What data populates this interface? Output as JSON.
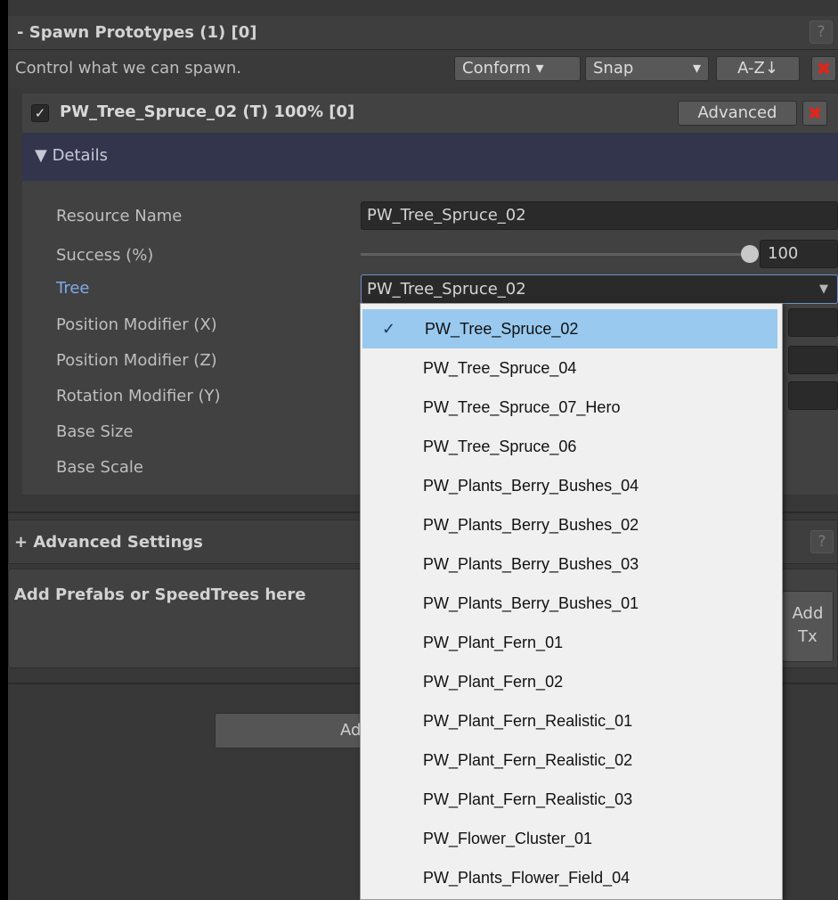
{
  "spawn_section": {
    "title": "- Spawn Prototypes (1) [0]",
    "help": "?",
    "description": "Control what we can spawn.",
    "toolbar": {
      "conform": "Conform ▾",
      "snap": "Snap",
      "snap_arrow": "▾",
      "sort": "A-Z↓",
      "delete": "✖"
    }
  },
  "prototype": {
    "checked": true,
    "check_glyph": "✓",
    "title": "PW_Tree_Spruce_02 (T) 100% [0]",
    "advanced_button": "Advanced",
    "delete": "✖"
  },
  "details": {
    "toggle_label": "▼ Details",
    "fields": {
      "resource_name_label": "Resource Name",
      "resource_name_value": "PW_Tree_Spruce_02",
      "success_label": "Success (%)",
      "success_value": "100",
      "tree_label": "Tree",
      "tree_value": "PW_Tree_Spruce_02",
      "tree_arrow": "▼",
      "position_x_label": "Position Modifier (X)",
      "position_z_label": "Position Modifier (Z)",
      "rotation_y_label": "Rotation Modifier (Y)",
      "base_size_label": "Base Size",
      "base_scale_label": "Base Scale"
    }
  },
  "advanced_settings": {
    "title": "+ Advanced Settings",
    "help": "?"
  },
  "add_area": {
    "title": "Add Prefabs or SpeedTrees here",
    "add_tx_line1": "Add",
    "add_tx_line2": "Tx"
  },
  "bottom_button": {
    "label": "Add"
  },
  "tree_dropdown": {
    "check_glyph": "✓",
    "options": [
      "PW_Tree_Spruce_02",
      "PW_Tree_Spruce_04",
      "PW_Tree_Spruce_07_Hero",
      "PW_Tree_Spruce_06",
      "PW_Plants_Berry_Bushes_04",
      "PW_Plants_Berry_Bushes_02",
      "PW_Plants_Berry_Bushes_03",
      "PW_Plants_Berry_Bushes_01",
      "PW_Plant_Fern_01",
      "PW_Plant_Fern_02",
      "PW_Plant_Fern_Realistic_01",
      "PW_Plant_Fern_Realistic_02",
      "PW_Plant_Fern_Realistic_03",
      "PW_Flower_Cluster_01",
      "PW_Plants_Flower_Field_04"
    ],
    "selected_index": 0
  },
  "colors": {
    "panel_bg": "#383838",
    "details_bar": "#33354d",
    "active_label": "#7fa9e8",
    "delete_red": "#e0251e",
    "dropdown_bg": "#f0f0f0",
    "dropdown_selected": "#99c9ef"
  }
}
